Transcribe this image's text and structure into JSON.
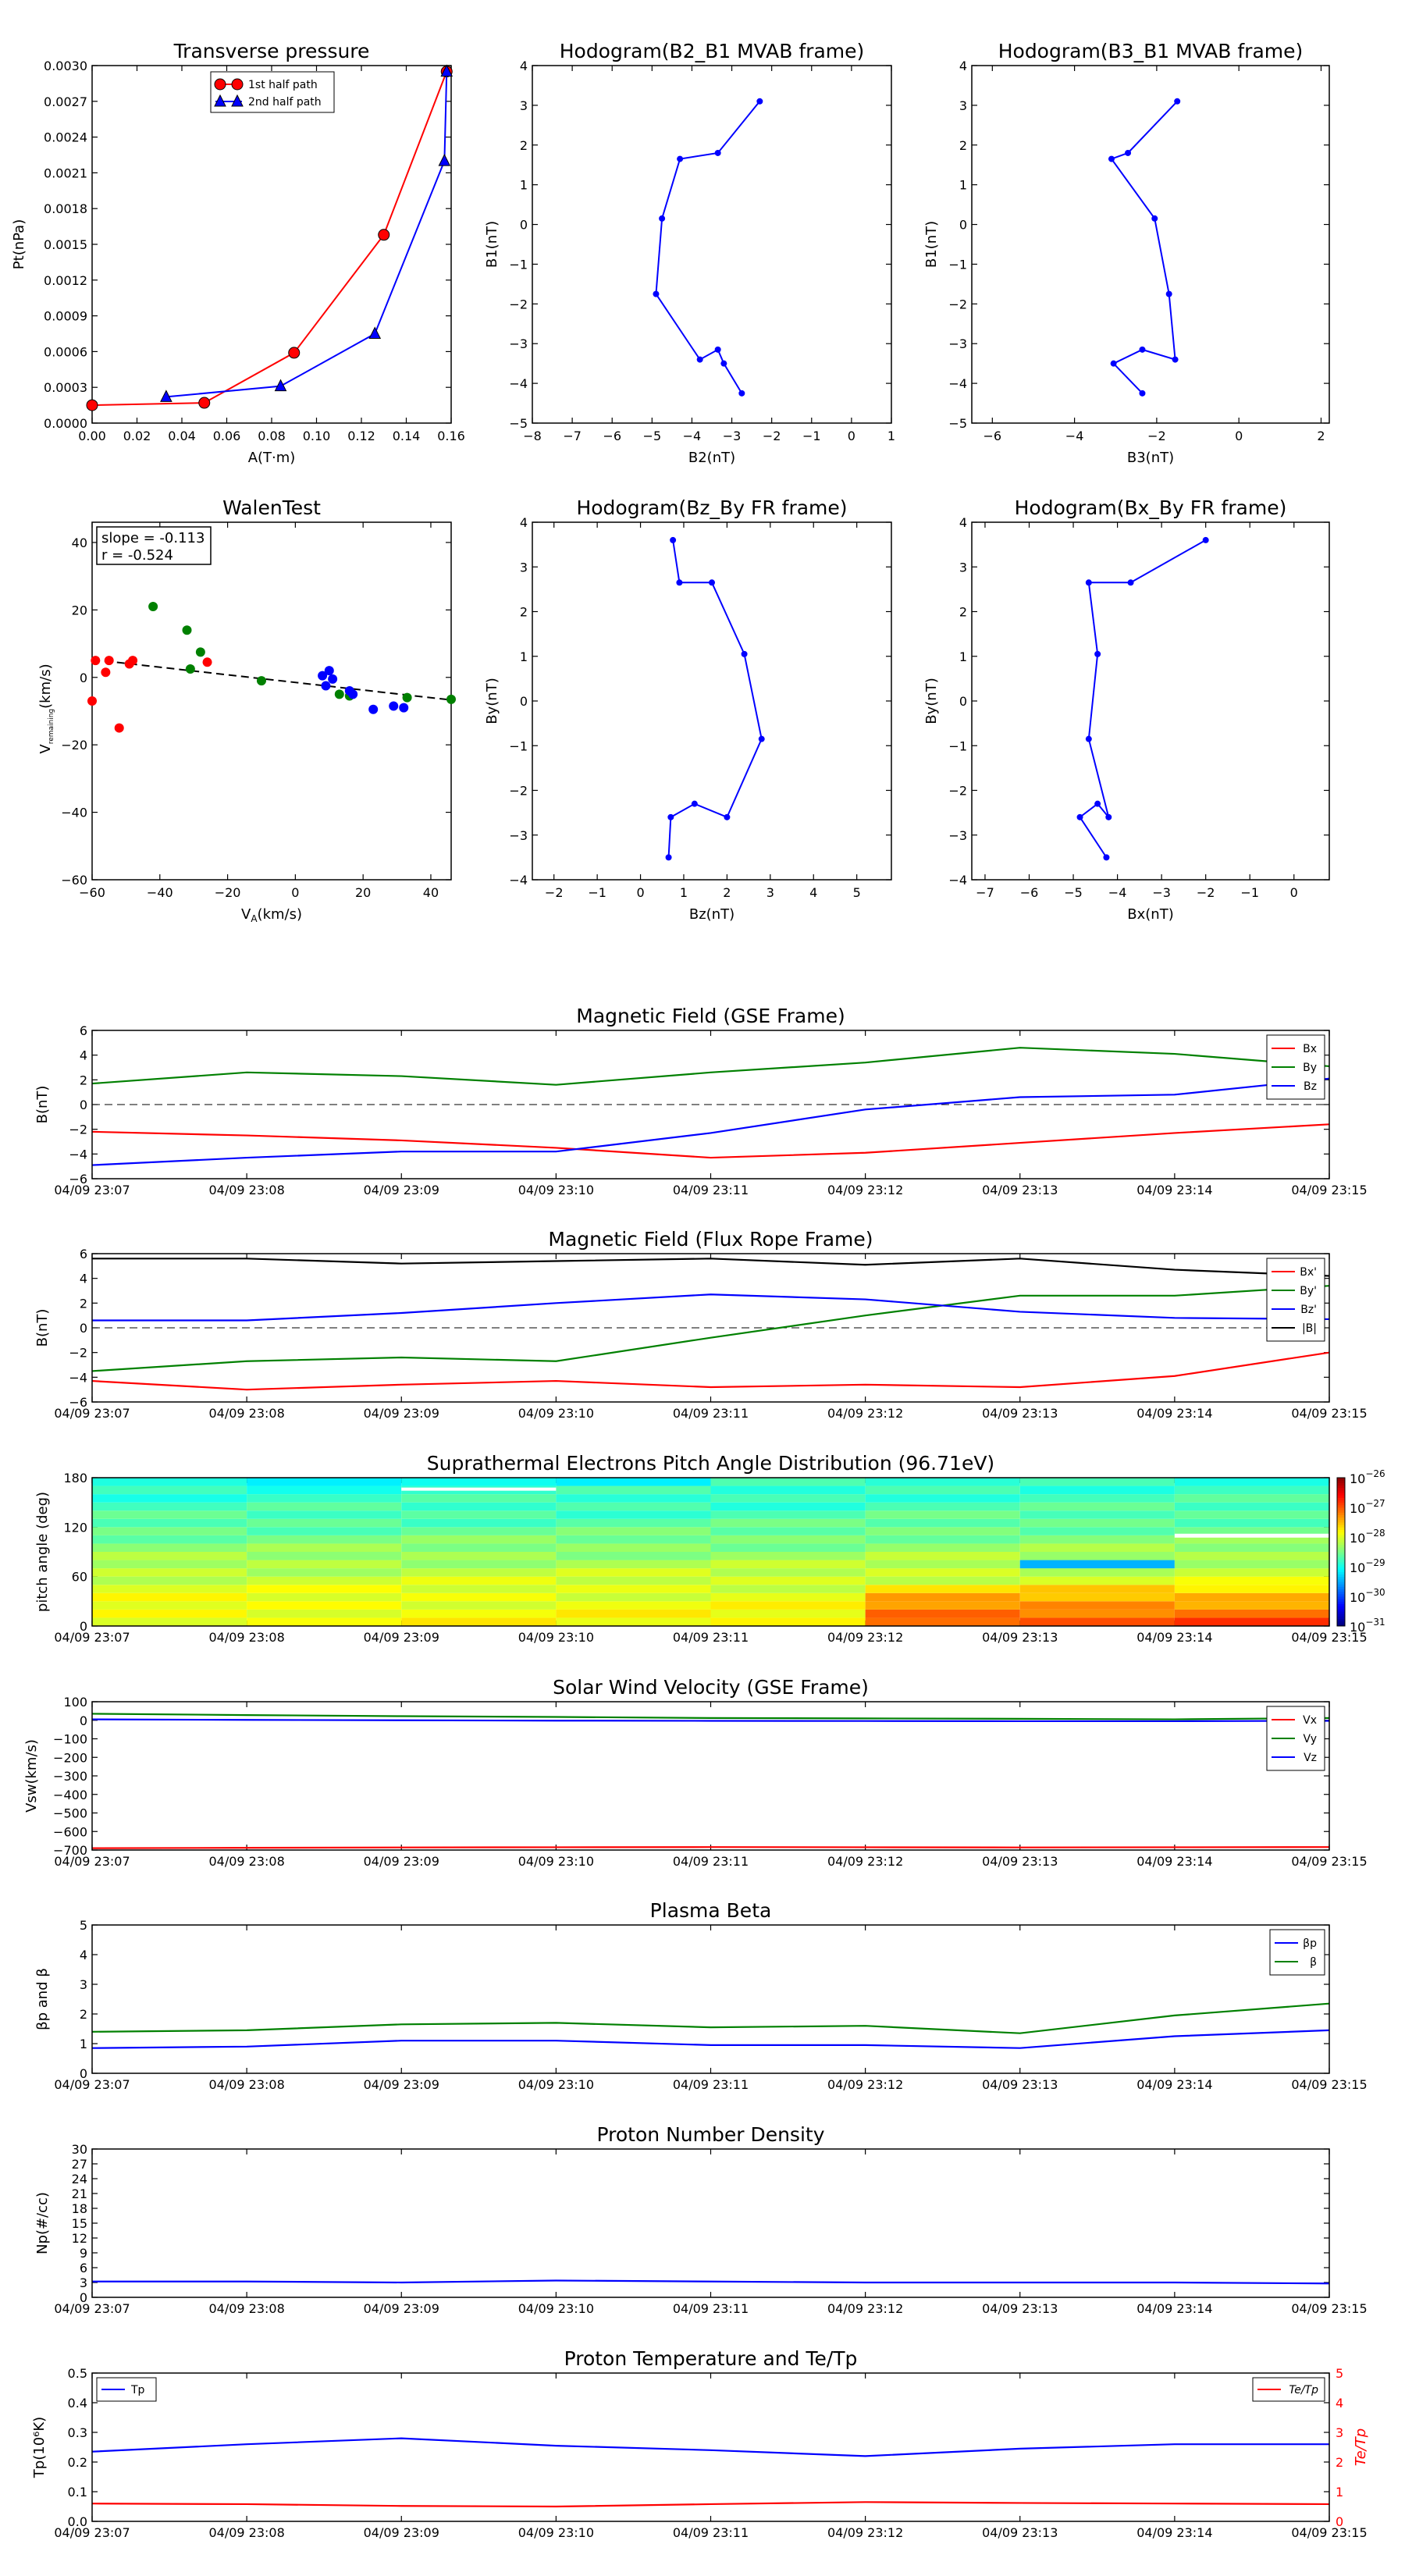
{
  "chart_data": [
    {
      "id": "tp",
      "type": "line",
      "title": "Transverse pressure",
      "xlabel": "A(T·m)",
      "ylabel": "Pt(nPa)",
      "xlim": [
        0,
        0.16
      ],
      "ylim": [
        0,
        0.003
      ],
      "xticks": [
        0,
        0.02,
        0.04,
        0.06,
        0.08,
        0.1,
        0.12,
        0.14,
        0.16
      ],
      "xticklabels": [
        "0.00",
        "0.02",
        "0.04",
        "0.06",
        "0.08",
        "0.10",
        "0.12",
        "0.14",
        "0.16"
      ],
      "yticks": [
        0,
        0.0003,
        0.0006,
        0.0009,
        0.0012,
        0.0015,
        0.0018,
        0.0021,
        0.0024,
        0.0027,
        0.003
      ],
      "yticklabels": [
        "0.0000",
        "0.0003",
        "0.0006",
        "0.0009",
        "0.0012",
        "0.0015",
        "0.0018",
        "0.0021",
        "0.0024",
        "0.0027",
        "0.0030"
      ],
      "legend_position": "top-center",
      "series": [
        {
          "name": "1st half path",
          "color": "#ff0000",
          "marker": "circle",
          "x": [
            0.0,
            0.05,
            0.09,
            0.13,
            0.158
          ],
          "y": [
            0.00015,
            0.00017,
            0.00059,
            0.00158,
            0.00295
          ]
        },
        {
          "name": "2nd half path",
          "color": "#0000ff",
          "marker": "triangle",
          "x": [
            0.158,
            0.157,
            0.126,
            0.084,
            0.033
          ],
          "y": [
            0.00295,
            0.0022,
            0.00075,
            0.00031,
            0.00022
          ]
        }
      ]
    },
    {
      "id": "hodo1",
      "type": "line",
      "title": "Hodogram(B2_B1 MVAB frame)",
      "xlabel": "B2(nT)",
      "ylabel": "B1(nT)",
      "xlim": [
        -8,
        1
      ],
      "ylim": [
        -5,
        4
      ],
      "xticks": [
        -8,
        -7,
        -6,
        -5,
        -4,
        -3,
        -2,
        -1,
        0,
        1
      ],
      "xticklabels": [
        "−8",
        "−7",
        "−6",
        "−5",
        "−4",
        "−3",
        "−2",
        "−1",
        "0",
        "1"
      ],
      "yticks": [
        -5,
        -4,
        -3,
        -2,
        -1,
        0,
        1,
        2,
        3,
        4
      ],
      "yticklabels": [
        "−5",
        "−4",
        "−3",
        "−2",
        "−1",
        "0",
        "1",
        "2",
        "3",
        "4"
      ],
      "series": [
        {
          "color": "#0000ff",
          "marker": "dot",
          "x": [
            -2.3,
            -3.35,
            -4.3,
            -4.75,
            -4.9,
            -3.8,
            -3.35,
            -3.2,
            -2.75
          ],
          "y": [
            3.1,
            1.8,
            1.65,
            0.15,
            -1.75,
            -3.4,
            -3.15,
            -3.5,
            -4.25
          ]
        }
      ]
    },
    {
      "id": "hodo2",
      "type": "line",
      "title": "Hodogram(B3_B1 MVAB frame)",
      "xlabel": "B3(nT)",
      "ylabel": "B1(nT)",
      "xlim": [
        -6.5,
        2.2
      ],
      "ylim": [
        -5,
        4
      ],
      "xticks": [
        -6,
        -4,
        -2,
        0,
        2
      ],
      "xticklabels": [
        "−6",
        "−4",
        "−2",
        "0",
        "2"
      ],
      "yticks": [
        -5,
        -4,
        -3,
        -2,
        -1,
        0,
        1,
        2,
        3,
        4
      ],
      "yticklabels": [
        "−5",
        "−4",
        "−3",
        "−2",
        "−1",
        "0",
        "1",
        "2",
        "3",
        "4"
      ],
      "series": [
        {
          "color": "#0000ff",
          "marker": "dot",
          "x": [
            -1.5,
            -2.7,
            -3.1,
            -2.05,
            -1.7,
            -1.55,
            -2.35,
            -3.05,
            -2.35
          ],
          "y": [
            3.1,
            1.8,
            1.65,
            0.15,
            -1.75,
            -3.4,
            -3.15,
            -3.5,
            -4.25
          ]
        }
      ]
    },
    {
      "id": "walen",
      "type": "scatter",
      "title": "WalenTest",
      "xlabel": "V_A(km/s)",
      "ylabel": "V_remaining(km/s)",
      "xlim": [
        -60,
        46
      ],
      "ylim": [
        -60,
        46
      ],
      "xticks": [
        -60,
        -40,
        -20,
        0,
        20,
        40
      ],
      "xticklabels": [
        "−60",
        "−40",
        "−20",
        "0",
        "20",
        "40"
      ],
      "yticks": [
        -60,
        -40,
        -20,
        0,
        20,
        40
      ],
      "yticklabels": [
        "−60",
        "−40",
        "−20",
        "0",
        "20",
        "40"
      ],
      "annotation": [
        "slope = -0.113",
        "r = -0.524"
      ],
      "fit_line": {
        "slope": -0.113,
        "intercept": -1.5,
        "style": "dashed"
      },
      "groups": [
        {
          "color": "#ff0000",
          "points": [
            [
              -60,
              -7
            ],
            [
              -59,
              5
            ],
            [
              -56,
              1.5
            ],
            [
              -55,
              5
            ],
            [
              -52,
              -15
            ],
            [
              -49,
              4
            ],
            [
              -48,
              5
            ],
            [
              -26,
              4.5
            ]
          ]
        },
        {
          "color": "#008000",
          "points": [
            [
              -42,
              21
            ],
            [
              -32,
              14
            ],
            [
              -31,
              2.5
            ],
            [
              -28,
              7.5
            ],
            [
              -10,
              -1
            ],
            [
              13,
              -5
            ],
            [
              16,
              -5.5
            ],
            [
              33,
              -6
            ],
            [
              46,
              -6.5
            ]
          ]
        },
        {
          "color": "#0000ff",
          "points": [
            [
              8,
              0.5
            ],
            [
              9,
              -2.5
            ],
            [
              10,
              2
            ],
            [
              11,
              -0.5
            ],
            [
              16,
              -4
            ],
            [
              17,
              -5
            ],
            [
              23,
              -9.5
            ],
            [
              29,
              -8.5
            ],
            [
              32,
              -9
            ]
          ]
        }
      ]
    },
    {
      "id": "hodo3",
      "type": "line",
      "title": "Hodogram(Bz_By FR frame)",
      "xlabel": "Bz(nT)",
      "ylabel": "By(nT)",
      "xlim": [
        -2.5,
        5.8
      ],
      "ylim": [
        -4,
        4
      ],
      "xticks": [
        -2,
        -1,
        0,
        1,
        2,
        3,
        4,
        5
      ],
      "xticklabels": [
        "−2",
        "−1",
        "0",
        "1",
        "2",
        "3",
        "4",
        "5"
      ],
      "yticks": [
        -4,
        -3,
        -2,
        -1,
        0,
        1,
        2,
        3,
        4
      ],
      "yticklabels": [
        "−4",
        "−3",
        "−2",
        "−1",
        "0",
        "1",
        "2",
        "3",
        "4"
      ],
      "series": [
        {
          "color": "#0000ff",
          "marker": "dot",
          "x": [
            0.75,
            0.9,
            1.65,
            2.4,
            2.8,
            2.0,
            1.25,
            0.7,
            0.65
          ],
          "y": [
            3.6,
            2.65,
            2.65,
            1.05,
            -0.85,
            -2.6,
            -2.3,
            -2.6,
            -3.5
          ]
        }
      ]
    },
    {
      "id": "hodo4",
      "type": "line",
      "title": "Hodogram(Bx_By FR frame)",
      "xlabel": "Bx(nT)",
      "ylabel": "By(nT)",
      "xlim": [
        -7.3,
        0.8
      ],
      "ylim": [
        -4,
        4
      ],
      "xticks": [
        -7,
        -6,
        -5,
        -4,
        -3,
        -2,
        -1,
        0
      ],
      "xticklabels": [
        "−7",
        "−6",
        "−5",
        "−4",
        "−3",
        "−2",
        "−1",
        "0"
      ],
      "yticks": [
        -4,
        -3,
        -2,
        -1,
        0,
        1,
        2,
        3,
        4
      ],
      "yticklabels": [
        "−4",
        "−3",
        "−2",
        "−1",
        "0",
        "1",
        "2",
        "3",
        "4"
      ],
      "series": [
        {
          "color": "#0000ff",
          "marker": "dot",
          "x": [
            -2.0,
            -3.7,
            -4.65,
            -4.45,
            -4.65,
            -4.2,
            -4.45,
            -4.85,
            -4.25
          ],
          "y": [
            3.6,
            2.65,
            2.65,
            1.05,
            -0.85,
            -2.6,
            -2.3,
            -2.6,
            -3.5
          ]
        }
      ]
    },
    {
      "id": "mag_gse",
      "type": "line",
      "title": "Magnetic Field (GSE Frame)",
      "ylabel": "B(nT)",
      "categories": [
        "04/09 23:07",
        "04/09 23:08",
        "04/09 23:09",
        "04/09 23:10",
        "04/09 23:11",
        "04/09 23:12",
        "04/09 23:13",
        "04/09 23:14",
        "04/09 23:15"
      ],
      "ylim": [
        -6,
        6
      ],
      "yticks": [
        -6,
        -4,
        -2,
        0,
        2,
        4,
        6
      ],
      "yticklabels": [
        "−6",
        "−4",
        "−2",
        "0",
        "2",
        "4",
        "6"
      ],
      "zero_line": true,
      "legend_position": "top-right",
      "series": [
        {
          "name": "Bx",
          "color": "#ff0000",
          "values": [
            -2.2,
            -2.5,
            -2.9,
            -3.5,
            -4.3,
            -3.9,
            -3.1,
            -2.3,
            -1.6
          ]
        },
        {
          "name": "By",
          "color": "#008000",
          "values": [
            1.7,
            2.6,
            2.3,
            1.6,
            2.6,
            3.4,
            4.6,
            4.1,
            3.1
          ]
        },
        {
          "name": "Bz",
          "color": "#0000ff",
          "values": [
            -4.9,
            -4.3,
            -3.8,
            -3.8,
            -2.3,
            -0.4,
            0.6,
            0.8,
            2.1
          ]
        }
      ]
    },
    {
      "id": "mag_fr",
      "type": "line",
      "title": "Magnetic Field (Flux Rope Frame)",
      "ylabel": "B(nT)",
      "categories": [
        "04/09 23:07",
        "04/09 23:08",
        "04/09 23:09",
        "04/09 23:10",
        "04/09 23:11",
        "04/09 23:12",
        "04/09 23:13",
        "04/09 23:14",
        "04/09 23:15"
      ],
      "ylim": [
        -6,
        6
      ],
      "yticks": [
        -6,
        -4,
        -2,
        0,
        2,
        4,
        6
      ],
      "yticklabels": [
        "−6",
        "−4",
        "−2",
        "0",
        "2",
        "4",
        "6"
      ],
      "zero_line": true,
      "legend_position": "top-right",
      "series": [
        {
          "name": "Bx'",
          "color": "#ff0000",
          "values": [
            -4.3,
            -5.0,
            -4.6,
            -4.3,
            -4.8,
            -4.6,
            -4.8,
            -3.9,
            -2.0
          ]
        },
        {
          "name": "By'",
          "color": "#008000",
          "values": [
            -3.5,
            -2.7,
            -2.4,
            -2.7,
            -0.8,
            1.0,
            2.6,
            2.6,
            3.4
          ]
        },
        {
          "name": "Bz'",
          "color": "#0000ff",
          "values": [
            0.6,
            0.6,
            1.2,
            2.0,
            2.7,
            2.3,
            1.3,
            0.8,
            0.7
          ]
        },
        {
          "name": "|B|",
          "color": "#000000",
          "values": [
            5.6,
            5.6,
            5.2,
            5.4,
            5.6,
            5.1,
            5.6,
            4.7,
            4.2
          ]
        }
      ]
    },
    {
      "id": "pad",
      "type": "heatmap",
      "title": "Suprathermal Electrons Pitch Angle Distribution (96.71eV)",
      "ylabel": "pitch angle (deg)",
      "categories": [
        "04/09 23:07",
        "04/09 23:08",
        "04/09 23:09",
        "04/09 23:10",
        "04/09 23:11",
        "04/09 23:12",
        "04/09 23:13",
        "04/09 23:14",
        "04/09 23:15"
      ],
      "ylim": [
        0,
        180
      ],
      "yticks": [
        0,
        60,
        120,
        180
      ],
      "yticklabels": [
        "0",
        "60",
        "120",
        "180"
      ],
      "colorbar_ticks": [
        {
          "base": "10",
          "exp": "-26"
        },
        {
          "base": "10",
          "exp": "-27"
        },
        {
          "base": "10",
          "exp": "-28"
        },
        {
          "base": "10",
          "exp": "-29"
        },
        {
          "base": "10",
          "exp": "-30"
        },
        {
          "base": "10",
          "exp": "-31"
        }
      ],
      "colorbar_range": [
        -31,
        -26
      ]
    },
    {
      "id": "vsw",
      "type": "line",
      "title": "Solar Wind Velocity (GSE Frame)",
      "ylabel": "Vsw(km/s)",
      "categories": [
        "04/09 23:07",
        "04/09 23:08",
        "04/09 23:09",
        "04/09 23:10",
        "04/09 23:11",
        "04/09 23:12",
        "04/09 23:13",
        "04/09 23:14",
        "04/09 23:15"
      ],
      "ylim": [
        -700,
        100
      ],
      "yticks": [
        -700,
        -600,
        -500,
        -400,
        -300,
        -200,
        -100,
        0,
        100
      ],
      "yticklabels": [
        "−700",
        "−600",
        "−500",
        "−400",
        "−300",
        "−200",
        "−100",
        "0",
        "100"
      ],
      "legend_position": "top-right",
      "series": [
        {
          "name": "Vx",
          "color": "#ff0000",
          "values": [
            -690,
            -688,
            -686,
            -685,
            -684,
            -685,
            -686,
            -685,
            -684
          ]
        },
        {
          "name": "Vy",
          "color": "#008000",
          "values": [
            35,
            28,
            22,
            18,
            12,
            10,
            8,
            5,
            12
          ]
        },
        {
          "name": "Vz",
          "color": "#0000ff",
          "values": [
            5,
            2,
            0,
            -2,
            -3,
            -4,
            -5,
            -5,
            -3
          ]
        }
      ]
    },
    {
      "id": "beta",
      "type": "line",
      "title": "Plasma Beta",
      "ylabel": "βp and β",
      "categories": [
        "04/09 23:07",
        "04/09 23:08",
        "04/09 23:09",
        "04/09 23:10",
        "04/09 23:11",
        "04/09 23:12",
        "04/09 23:13",
        "04/09 23:14",
        "04/09 23:15"
      ],
      "ylim": [
        0,
        5
      ],
      "yticks": [
        0,
        1,
        2,
        3,
        4,
        5
      ],
      "yticklabels": [
        "0",
        "1",
        "2",
        "3",
        "4",
        "5"
      ],
      "legend_position": "top-right",
      "series": [
        {
          "name": "βp",
          "color": "#0000ff",
          "values": [
            0.85,
            0.9,
            1.1,
            1.1,
            0.95,
            0.95,
            0.85,
            1.25,
            1.45
          ]
        },
        {
          "name": "β",
          "color": "#008000",
          "values": [
            1.4,
            1.45,
            1.65,
            1.7,
            1.55,
            1.6,
            1.35,
            1.95,
            2.35
          ]
        }
      ]
    },
    {
      "id": "np",
      "type": "line",
      "title": "Proton Number Density",
      "ylabel": "Np(#/cc)",
      "categories": [
        "04/09 23:07",
        "04/09 23:08",
        "04/09 23:09",
        "04/09 23:10",
        "04/09 23:11",
        "04/09 23:12",
        "04/09 23:13",
        "04/09 23:14",
        "04/09 23:15"
      ],
      "ylim": [
        0,
        30
      ],
      "yticks": [
        0,
        3,
        6,
        9,
        12,
        15,
        18,
        21,
        24,
        27,
        30
      ],
      "yticklabels": [
        "0",
        "3",
        "6",
        "9",
        "12",
        "15",
        "18",
        "21",
        "24",
        "27",
        "30"
      ],
      "series": [
        {
          "name": "Np",
          "color": "#0000ff",
          "values": [
            3.2,
            3.2,
            3.0,
            3.4,
            3.2,
            3.0,
            3.0,
            3.0,
            2.8
          ]
        }
      ]
    },
    {
      "id": "temp",
      "type": "line",
      "title": "Proton Temperature and Te/Tp",
      "ylabel": "Tp(10⁶K)",
      "ylabel_right": "Te/Tp",
      "categories": [
        "04/09 23:07",
        "04/09 23:08",
        "04/09 23:09",
        "04/09 23:10",
        "04/09 23:11",
        "04/09 23:12",
        "04/09 23:13",
        "04/09 23:14",
        "04/09 23:15"
      ],
      "ylim": [
        0,
        0.5
      ],
      "yticks": [
        0,
        0.1,
        0.2,
        0.3,
        0.4,
        0.5
      ],
      "yticklabels": [
        "0.0",
        "0.1",
        "0.2",
        "0.3",
        "0.4",
        "0.5"
      ],
      "ylim_right": [
        0,
        5
      ],
      "yticks_right": [
        0,
        1,
        2,
        3,
        4,
        5
      ],
      "yticklabels_right": [
        "0",
        "1",
        "2",
        "3",
        "4",
        "5"
      ],
      "series": [
        {
          "name": "Tp",
          "color": "#0000ff",
          "axis": "left",
          "values": [
            0.235,
            0.26,
            0.28,
            0.255,
            0.24,
            0.22,
            0.245,
            0.26,
            0.26
          ]
        },
        {
          "name": "Te/Tp",
          "color": "#ff0000",
          "axis": "right",
          "values": [
            0.6,
            0.58,
            0.52,
            0.5,
            0.58,
            0.65,
            0.62,
            0.6,
            0.58
          ]
        }
      ]
    }
  ]
}
